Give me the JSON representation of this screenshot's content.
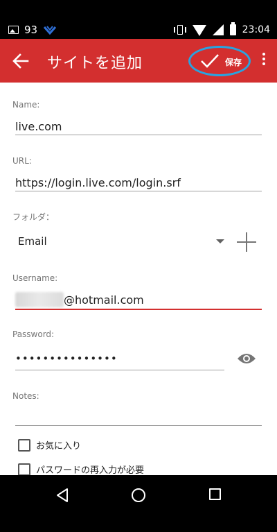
{
  "status_bar": {
    "notification_count": "93",
    "time": "23:04",
    "icons": [
      "image-icon",
      "brand-icon",
      "vibrate-icon",
      "wifi-icon",
      "signal-icon",
      "battery-icon"
    ]
  },
  "app_bar": {
    "title": "サイトを追加",
    "save_label": "保存",
    "accent_color": "#d32f2f",
    "highlight_color": "#29a3e0"
  },
  "form": {
    "name": {
      "label": "Name:",
      "value": "live.com"
    },
    "url": {
      "label": "URL:",
      "value": "https://login.live.com/login.srf"
    },
    "folder": {
      "label": "フォルダ：",
      "value": "Email"
    },
    "username": {
      "label": "Username:",
      "value": "@hotmail.com"
    },
    "password": {
      "label": "Password:",
      "value": "•••••••••••••••"
    },
    "notes": {
      "label": "Notes:",
      "value": ""
    },
    "checkboxes": [
      {
        "label": "お気に入り",
        "checked": false
      },
      {
        "label": "パスワードの再入力が必要",
        "checked": false
      }
    ]
  },
  "nav_bar": {
    "icons": [
      "back-triangle-icon",
      "home-circle-icon",
      "recents-square-icon"
    ]
  }
}
